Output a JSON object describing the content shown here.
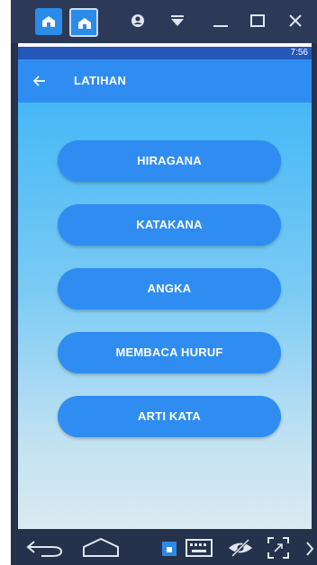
{
  "emulator": {
    "tabs": [
      {
        "name": "home-tab",
        "icon": "home-icon"
      },
      {
        "name": "app-tab",
        "icon": "home-icon"
      }
    ],
    "controls": [
      "camera-icon",
      "dropdown-icon",
      "minimize-icon",
      "maximize-icon",
      "close-icon"
    ],
    "bottom_controls": [
      "back-icon",
      "home-icon",
      "app-switch-icon",
      "keyboard-icon",
      "eye-hide-icon",
      "fullscreen-icon",
      "chevron-right-icon"
    ]
  },
  "status_bar": {
    "time": "7:56"
  },
  "toolbar": {
    "title": "LATIHAN",
    "back_icon": "arrow-left-icon"
  },
  "menu": {
    "items": [
      {
        "label": "HIRAGANA"
      },
      {
        "label": "KATAKANA"
      },
      {
        "label": "ANGKA"
      },
      {
        "label": "MEMBACA HURUF"
      },
      {
        "label": "ARTI KATA"
      }
    ]
  },
  "colors": {
    "toolbar": "#2f8df2",
    "status_bar": "#2357b8",
    "button": "#2f8df2",
    "gradient_top": "#46b8f6",
    "gradient_bottom": "#dbeaf2",
    "emulator_frame": "#26324b"
  }
}
